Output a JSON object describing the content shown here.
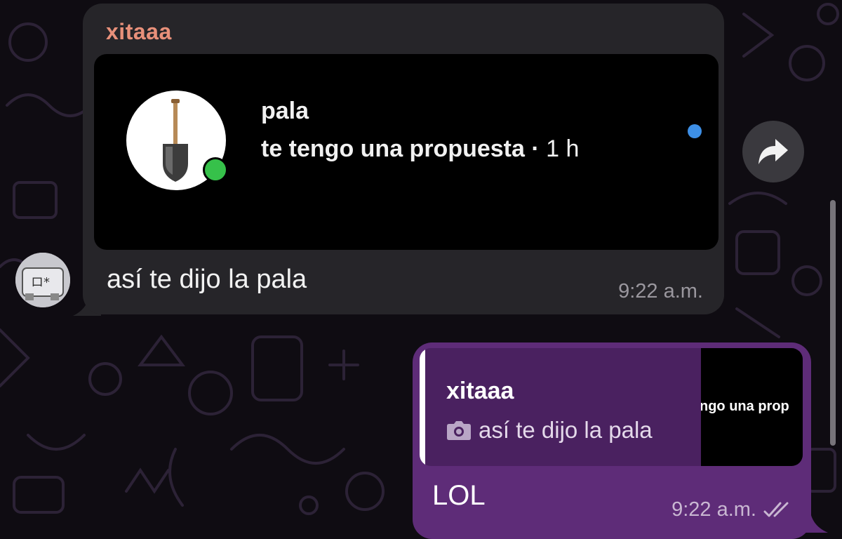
{
  "incoming": {
    "sender": "xitaaa",
    "photo": {
      "title": "pala",
      "body": "te tengo una propuesta",
      "separator": " · ",
      "time": "1 h"
    },
    "text": "así te dijo la pala",
    "time": "9:22 a.m."
  },
  "outgoing": {
    "reply": {
      "name": "xitaaa",
      "text": "así te dijo la pala",
      "thumb_text": "ngo una prop"
    },
    "text": "LOL",
    "time": "9:22 a.m."
  },
  "icons": {
    "forward": "forward-arrow-icon",
    "camera": "camera-icon",
    "read": "double-check-icon",
    "shovel": "shovel-icon"
  },
  "colors": {
    "incoming_bubble": "#262529",
    "outgoing_bubble": "#5e2c78",
    "sender_name": "#e8907a",
    "online": "#36c14a",
    "unread": "#3d8fe6"
  }
}
